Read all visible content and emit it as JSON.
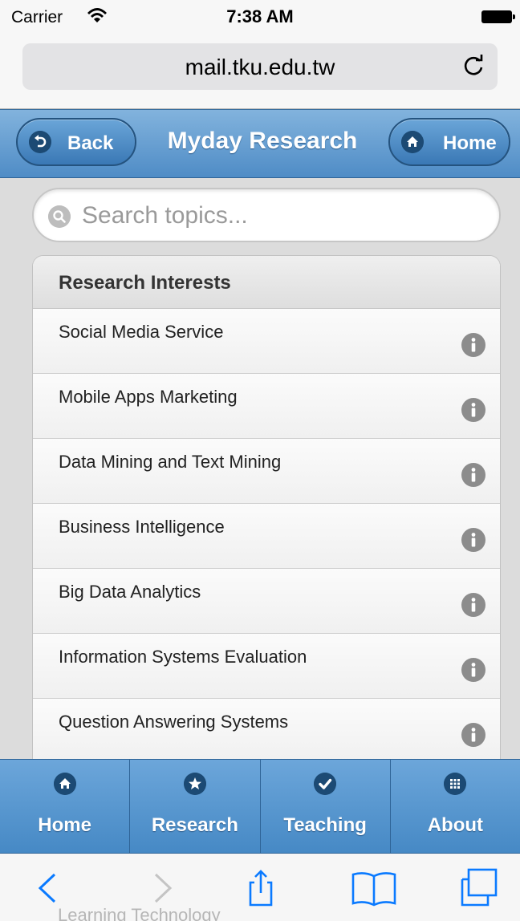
{
  "status_bar": {
    "carrier": "Carrier",
    "time": "7:38 AM"
  },
  "browser": {
    "url": "mail.tku.edu.tw"
  },
  "header": {
    "title": "Myday Research",
    "back_label": "Back",
    "home_label": "Home"
  },
  "search": {
    "placeholder": "Search topics..."
  },
  "list": {
    "heading": "Research Interests",
    "items": [
      {
        "label": "Social Media Service"
      },
      {
        "label": "Mobile Apps Marketing"
      },
      {
        "label": "Data Mining and Text Mining"
      },
      {
        "label": "Business Intelligence"
      },
      {
        "label": "Big Data Analytics"
      },
      {
        "label": "Information Systems Evaluation"
      },
      {
        "label": "Question Answering Systems"
      }
    ],
    "partially_hidden_item": "Learning Technology"
  },
  "tabbar": {
    "tabs": [
      {
        "label": "Home",
        "icon": "home-icon"
      },
      {
        "label": "Research",
        "icon": "star-icon"
      },
      {
        "label": "Teaching",
        "icon": "check-icon"
      },
      {
        "label": "About",
        "icon": "grid-icon"
      }
    ]
  },
  "colors": {
    "header_blue": "#4f8cc6",
    "tab_blue": "#5a98d0",
    "icon_dark": "#1c4a74",
    "ios_blue": "#0a7aff"
  }
}
